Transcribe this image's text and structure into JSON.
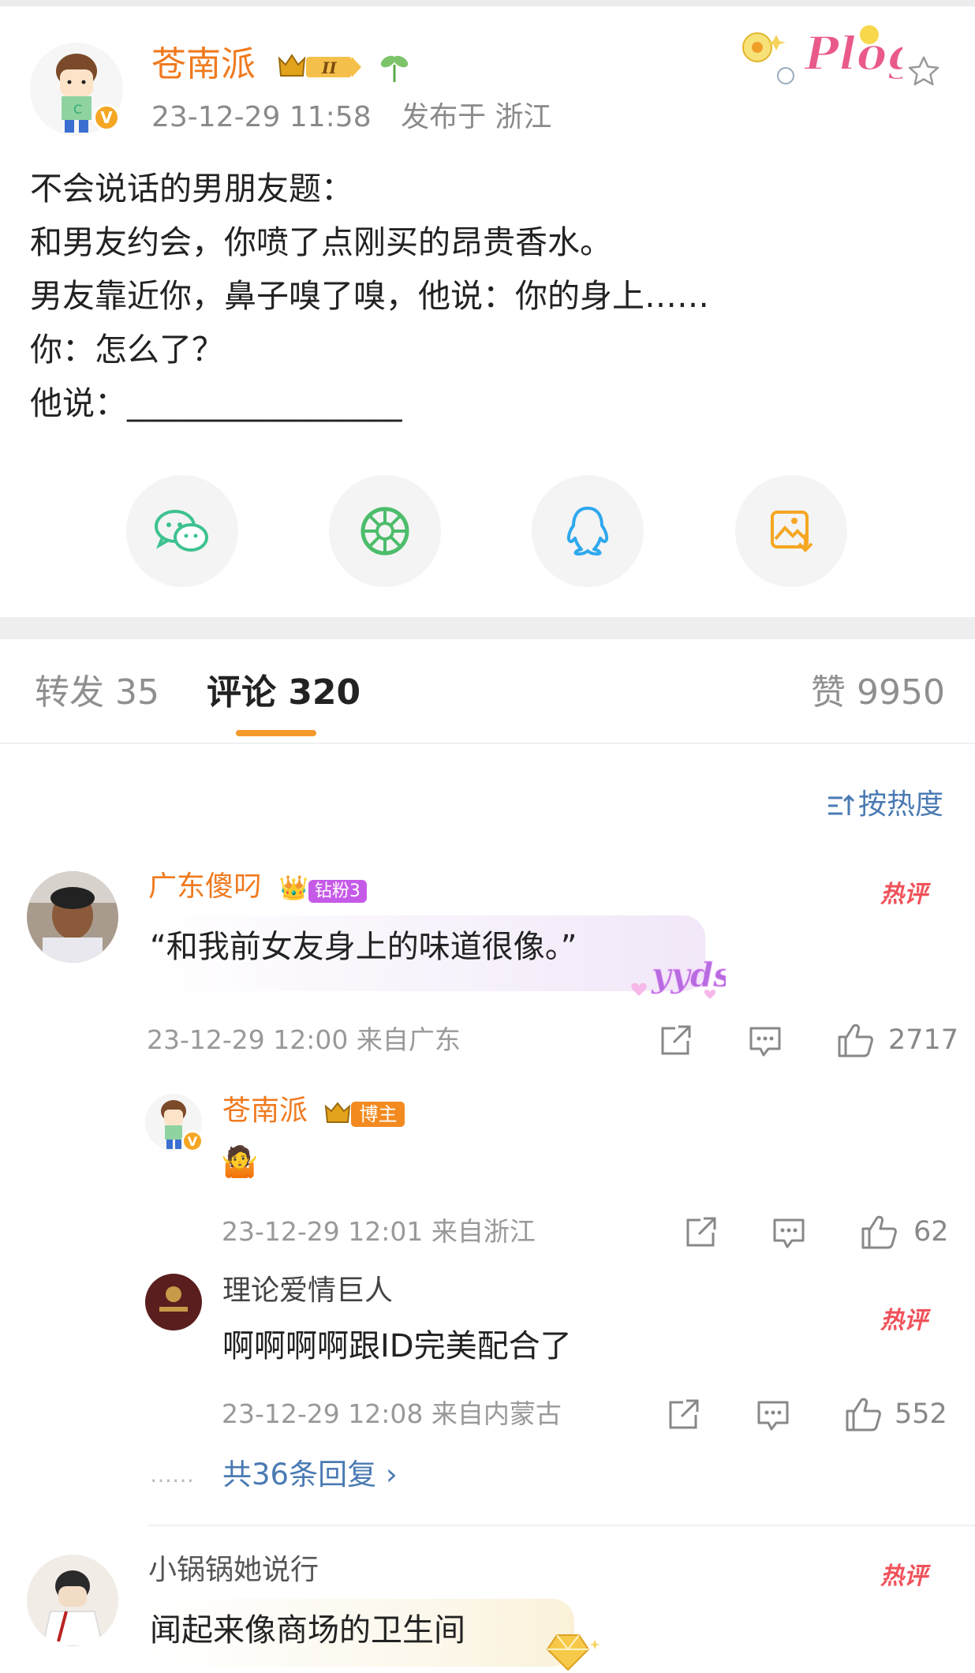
{
  "post": {
    "author": "苍南派",
    "timestamp": "23-12-29 11:58",
    "location": "发布于 浙江",
    "decoration_text": "Plog",
    "lines": [
      "不会说话的男朋友题：",
      "和男友约会，你喷了点刚买的昂贵香水。",
      "男友靠近你，鼻子嗅了嗅，他说：你的身上……",
      "你：怎么了？",
      "他说：_________________"
    ],
    "share_icons": [
      "wechat-icon",
      "moments-icon",
      "qq-icon",
      "save-image-icon"
    ]
  },
  "tabs": {
    "repost_label": "转发 35",
    "comments_label": "评论 320",
    "likes_label": "赞 9950"
  },
  "sort": {
    "label": "按热度"
  },
  "comments": [
    {
      "name": "广东傻叼",
      "badge": "钻粉3",
      "text": "“和我前女友身上的味道很像。”",
      "sticker": "yyds",
      "time": "23-12-29 12:00  来自广东",
      "likes": "2717",
      "hot": "热评",
      "replies": [
        {
          "name": "苍南派",
          "badge": "博主",
          "emoji": "🤷",
          "time": "23-12-29 12:01  来自浙江",
          "likes": "62"
        },
        {
          "name": "理论爱情巨人",
          "text": "啊啊啊啊跟ID完美配合了",
          "time": "23-12-29 12:08  来自内蒙古",
          "likes": "552",
          "hot": "热评"
        }
      ],
      "more_replies": "共36条回复 ›",
      "dots": "……"
    },
    {
      "name": "小锅锅她说行",
      "text": "闻起来像商场的卫生间",
      "hot": "热评"
    }
  ],
  "colors": {
    "username_orange": "#f07a1f",
    "link_blue": "#4a7ab3",
    "tab_underline": "#f39a2a",
    "hot_red": "#f0525b"
  }
}
